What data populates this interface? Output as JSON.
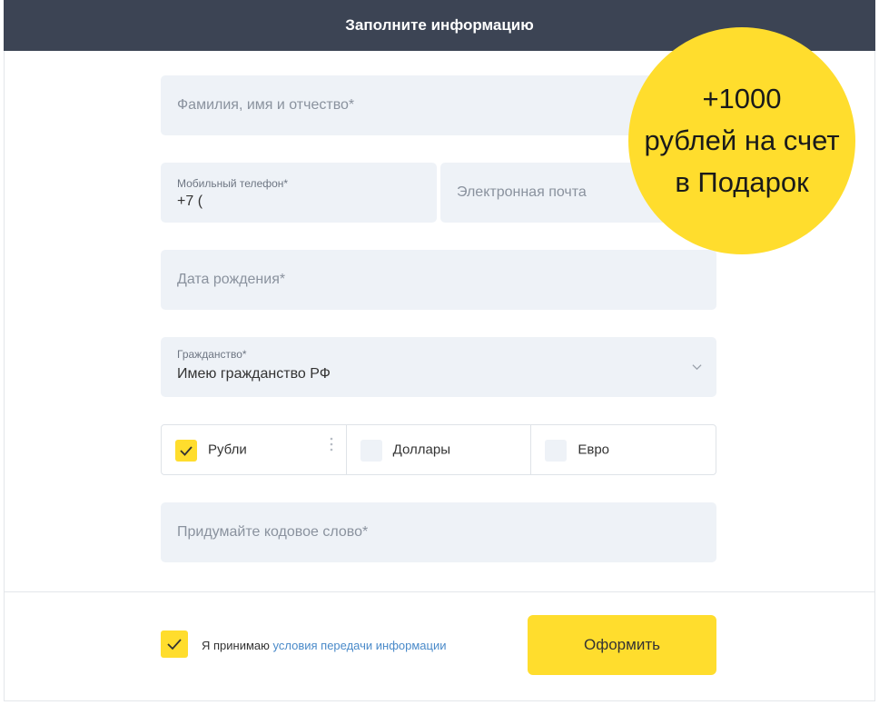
{
  "header": {
    "title": "Заполните информацию"
  },
  "form": {
    "full_name": {
      "placeholder": "Фамилия, имя и отчество*"
    },
    "phone": {
      "label": "Мобильный телефон*",
      "value": "+7 ("
    },
    "email": {
      "placeholder": "Электронная почта"
    },
    "birth_date": {
      "placeholder": "Дата рождения*"
    },
    "citizenship": {
      "label": "Гражданство*",
      "value": "Имею гражданство РФ",
      "icon": "chevron-down-icon"
    },
    "currencies": [
      {
        "label": "Рубли",
        "checked": true
      },
      {
        "label": "Доллары",
        "checked": false
      },
      {
        "label": "Евро",
        "checked": false
      }
    ],
    "code_word": {
      "placeholder": "Придумайте кодовое слово*"
    }
  },
  "footer": {
    "agree_checked": true,
    "agree_prefix": "Я принимаю",
    "agree_link": "условия передачи информации",
    "submit_label": "Оформить"
  },
  "promo": {
    "line1": "+1000",
    "line2": "рублей на счет",
    "line3": "в Подарок"
  },
  "colors": {
    "header_bg": "#3c4454",
    "accent": "#ffdd2d",
    "field_bg": "#eef2f7",
    "link": "#4a8ac9"
  }
}
